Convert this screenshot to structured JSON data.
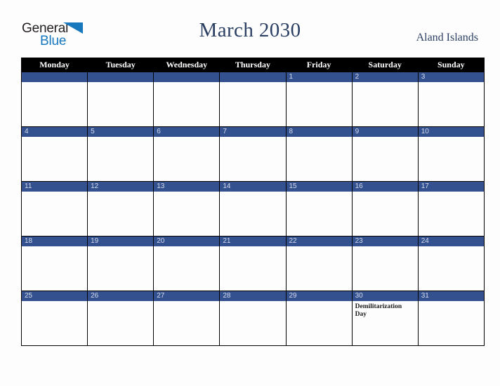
{
  "brand": {
    "name_part1": "General",
    "name_part2": "Blue",
    "triangle_icon": "triangle-icon",
    "color_dark": "#231f20",
    "color_blue": "#1878be"
  },
  "header": {
    "title": "March 2030",
    "region": "Aland Islands",
    "title_color": "#2b3f63"
  },
  "calendar": {
    "weekday_headers": [
      "Monday",
      "Tuesday",
      "Wednesday",
      "Thursday",
      "Friday",
      "Saturday",
      "Sunday"
    ],
    "header_bg": "#000000",
    "header_text_color": "#ffffff",
    "daynum_band_color": "#33518f",
    "daynum_text_color": "#d6dced",
    "cell_bg": "#fdfdfd",
    "border_color": "#000000",
    "weeks": [
      [
        {
          "day": "",
          "event": ""
        },
        {
          "day": "",
          "event": ""
        },
        {
          "day": "",
          "event": ""
        },
        {
          "day": "",
          "event": ""
        },
        {
          "day": "1",
          "event": ""
        },
        {
          "day": "2",
          "event": ""
        },
        {
          "day": "3",
          "event": ""
        }
      ],
      [
        {
          "day": "4",
          "event": ""
        },
        {
          "day": "5",
          "event": ""
        },
        {
          "day": "6",
          "event": ""
        },
        {
          "day": "7",
          "event": ""
        },
        {
          "day": "8",
          "event": ""
        },
        {
          "day": "9",
          "event": ""
        },
        {
          "day": "10",
          "event": ""
        }
      ],
      [
        {
          "day": "11",
          "event": ""
        },
        {
          "day": "12",
          "event": ""
        },
        {
          "day": "13",
          "event": ""
        },
        {
          "day": "14",
          "event": ""
        },
        {
          "day": "15",
          "event": ""
        },
        {
          "day": "16",
          "event": ""
        },
        {
          "day": "17",
          "event": ""
        }
      ],
      [
        {
          "day": "18",
          "event": ""
        },
        {
          "day": "19",
          "event": ""
        },
        {
          "day": "20",
          "event": ""
        },
        {
          "day": "21",
          "event": ""
        },
        {
          "day": "22",
          "event": ""
        },
        {
          "day": "23",
          "event": ""
        },
        {
          "day": "24",
          "event": ""
        }
      ],
      [
        {
          "day": "25",
          "event": ""
        },
        {
          "day": "26",
          "event": ""
        },
        {
          "day": "27",
          "event": ""
        },
        {
          "day": "28",
          "event": ""
        },
        {
          "day": "29",
          "event": ""
        },
        {
          "day": "30",
          "event": "Demilitarization Day"
        },
        {
          "day": "31",
          "event": ""
        }
      ]
    ]
  }
}
